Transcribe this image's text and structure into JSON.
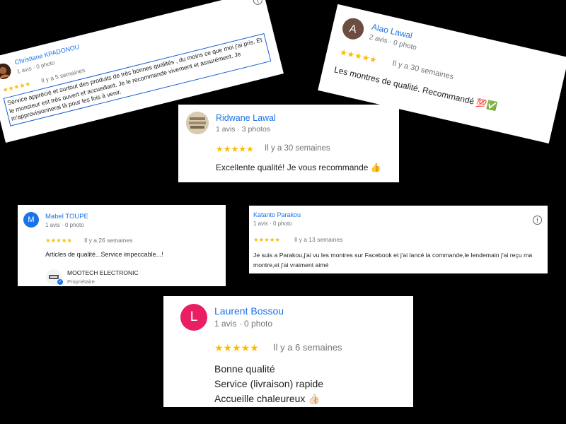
{
  "reviews": [
    {
      "initial": "",
      "name": "Christiane KPADONOU",
      "meta": "1 avis · 0 photo",
      "stars": "★★★★★",
      "time": "Il y a 5 semaines",
      "text": "Service apprécié et surtout des produits de très bonnes qualités , du moins ce que moi j'ai pris. Et le monsieur est très ouvert et accueillant. Je le recommande vivement et assurément. Je m'approvisionnerai là pour les fois à venir."
    },
    {
      "initial": "A",
      "name": "Alao Lawal",
      "meta": "2 avis · 0 photo",
      "stars": "★★★★★",
      "time": "Il y a 30 semaines",
      "text": "Les montres de qualité. Recommandé 💯✅"
    },
    {
      "initial": "",
      "name": "Ridwane Lawal",
      "meta": "1 avis · 3 photos",
      "stars": "★★★★★",
      "time": "Il y a 30 semaines",
      "text": "Excellente qualité! Je vous recommande 👍"
    },
    {
      "initial": "M",
      "name": "Mabel TOUPE",
      "meta": "1 avis · 0 photo",
      "stars": "★★★★★",
      "time": "Il y a 26 semaines",
      "text": "Articles de qualité...Service impeccable...!",
      "owner_name": "MOOTECH ELECTRONIC",
      "owner_role": "Propriétaire"
    },
    {
      "initial": "",
      "name": "Katanto Parakou",
      "meta": "1 avis · 0 photo",
      "stars": "★★★★★",
      "time": "Il y a 13 semaines",
      "text": "Je suis a Parakou,j'ai vu les montres sur Facebook et j'ai lancé la commande,le lendemain j'ai reçu ma montre,et j'ai vraiment aimé"
    },
    {
      "initial": "L",
      "name": "Laurent Bossou",
      "meta": "1 avis · 0 photo",
      "stars": "★★★★★",
      "time": "Il y a 6 semaines",
      "text_lines": [
        "Bonne qualité",
        "Service (livraison) rapide",
        "Accueille chaleureux 👍🏻"
      ]
    }
  ],
  "colors": {
    "name": "#1a73e8",
    "star": "#fbbc04",
    "avatar_a": "#6d4c41",
    "avatar_m": "#1a73e8",
    "avatar_l": "#e91e63"
  },
  "icons": {
    "flag": "flag-icon",
    "verified": "verified-icon"
  }
}
